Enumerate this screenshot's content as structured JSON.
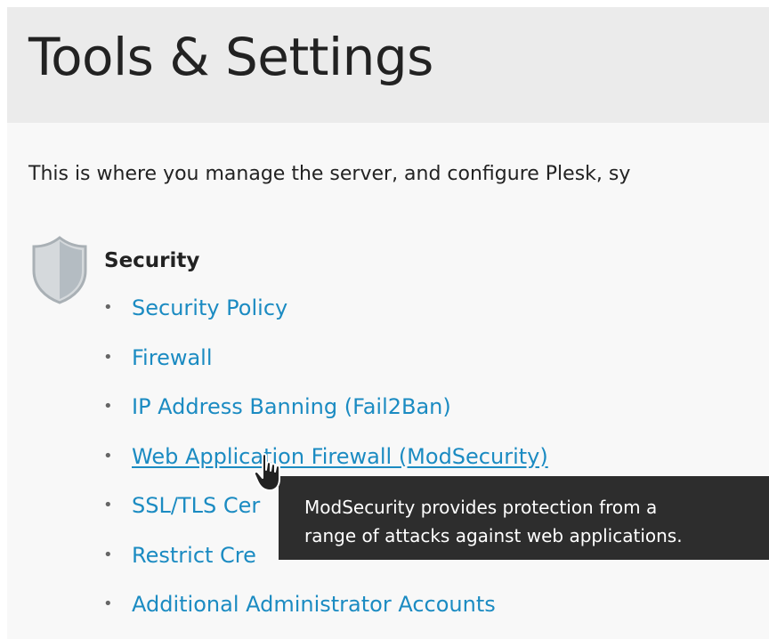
{
  "header": {
    "title": "Tools & Settings"
  },
  "intro": {
    "text": "This is where you manage the server, and configure Plesk, sy"
  },
  "security": {
    "icon": "shield-icon",
    "heading": "Security",
    "links": [
      {
        "label": "Security Policy"
      },
      {
        "label": "Firewall"
      },
      {
        "label": "IP Address Banning (Fail2Ban)"
      },
      {
        "label": "Web Application Firewall (ModSecurity)"
      },
      {
        "label": "SSL/TLS Cer"
      },
      {
        "label": "Restrict Cre"
      },
      {
        "label": "Additional Administrator Accounts"
      }
    ]
  },
  "tooltip": {
    "line1": "ModSecurity provides protection from a",
    "line2": "range of attacks against web applications."
  },
  "colors": {
    "link": "#1b8bc2",
    "header_bg": "#ebebeb",
    "page_bg": "#f8f8f8",
    "tooltip_bg": "#2d2d2d"
  }
}
